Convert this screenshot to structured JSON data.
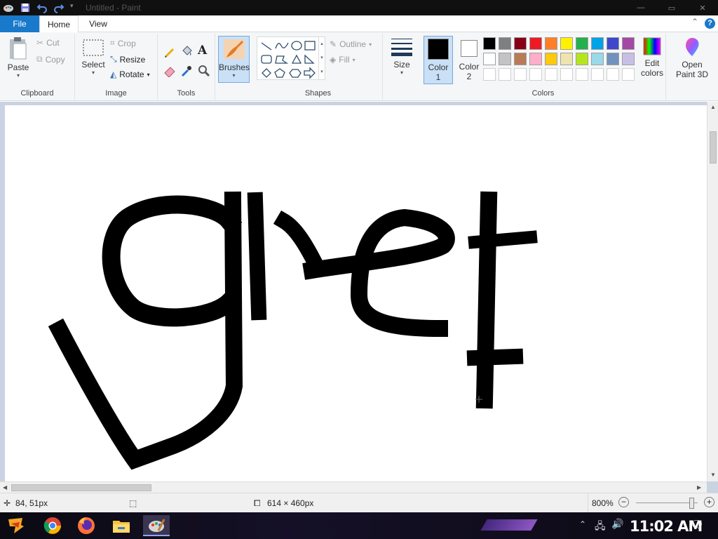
{
  "window": {
    "title": "Untitled - Paint"
  },
  "tabs": {
    "file": "File",
    "home": "Home",
    "view": "View",
    "help": "?"
  },
  "clipboard": {
    "paste": "Paste",
    "cut": "Cut",
    "copy": "Copy",
    "label": "Clipboard"
  },
  "image": {
    "select": "Select",
    "crop": "Crop",
    "resize": "Resize",
    "rotate": "Rotate",
    "label": "Image"
  },
  "tools": {
    "label": "Tools"
  },
  "brushes": {
    "label": "Brushes"
  },
  "shapes": {
    "outline": "Outline",
    "fill": "Fill",
    "label": "Shapes"
  },
  "size": {
    "label": "Size"
  },
  "colors": {
    "color1_line1": "Color",
    "color1_line2": "1",
    "color2_line1": "Color",
    "color2_line2": "2",
    "label": "Colors",
    "edit_line1": "Edit",
    "edit_line2": "colors",
    "color1_value": "#000000",
    "color2_value": "#ffffff",
    "palette_row1": [
      "#000000",
      "#7f7f7f",
      "#880015",
      "#ed1c24",
      "#ff7f27",
      "#fff200",
      "#22b14c",
      "#00a2e8",
      "#3f48cc",
      "#a349a4"
    ],
    "palette_row2": [
      "#ffffff",
      "#c3c3c3",
      "#b97a57",
      "#ffaec9",
      "#ffc90e",
      "#efe4b0",
      "#b5e61d",
      "#99d9ea",
      "#7092be",
      "#c8bfe7"
    ]
  },
  "paint3d": {
    "line1": "Open",
    "line2": "Paint 3D"
  },
  "status": {
    "cursor_pos": "84, 51px",
    "canvas_size": "614 × 460px",
    "zoom": "800%"
  },
  "zoom_slider": {
    "level": 0.95
  },
  "taskbar": {
    "clock": "11:02 AM"
  }
}
